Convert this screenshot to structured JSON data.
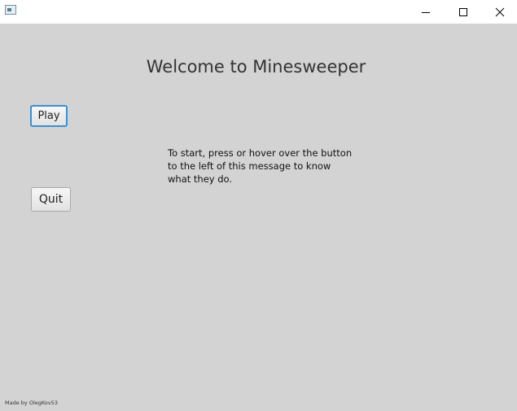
{
  "window": {
    "controls": {
      "minimize_icon": "minimize-icon",
      "maximize_icon": "maximize-icon",
      "close_icon": "close-icon"
    }
  },
  "main": {
    "title": "Welcome to Minesweeper",
    "play_label": "Play",
    "quit_label": "Quit",
    "message": "To start, press or hover over the button to the left of this message to know what they do.",
    "footer": "Made by OlegKov53"
  },
  "colors": {
    "background": "#d3d3d3",
    "focus_border": "#3d8fd1"
  }
}
